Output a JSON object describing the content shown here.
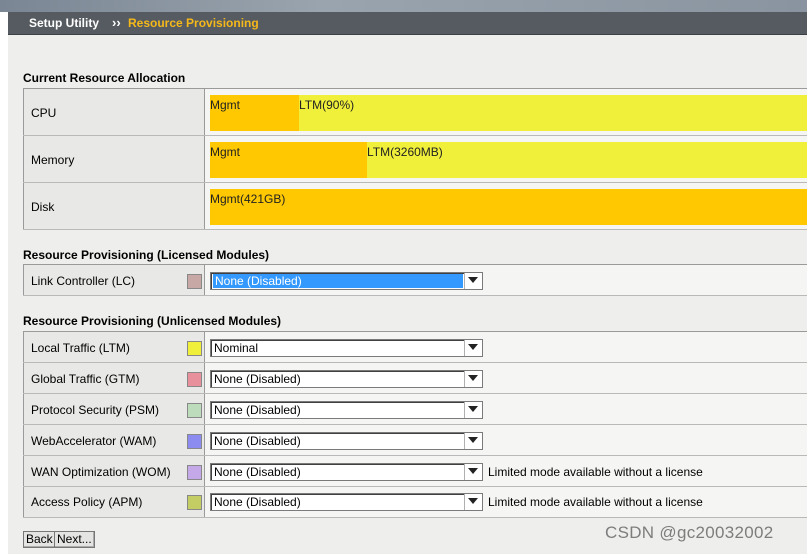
{
  "header": {
    "crumb_root": "Setup Utility",
    "crumb_sep": "››",
    "crumb_current": "Resource Provisioning"
  },
  "allocation": {
    "title": "Current Resource Allocation",
    "rows": [
      {
        "label": "CPU",
        "mgmt_label": "Mgmt",
        "ltm_label": "LTM(90%)",
        "mgmt_fraction": 0.149
      },
      {
        "label": "Memory",
        "mgmt_label": "Mgmt",
        "ltm_label": "LTM(3260MB)",
        "mgmt_fraction": 0.263
      },
      {
        "label": "Disk",
        "mgmt_label": "Mgmt(421GB)",
        "ltm_label": "",
        "mgmt_fraction": 1.0
      }
    ],
    "colors": {
      "mgmt": "#ffc800",
      "ltm": "#f0f03a"
    }
  },
  "licensed": {
    "title": "Resource Provisioning (Licensed Modules)",
    "modules": [
      {
        "label": "Link Controller (LC)",
        "swatch": "#c8a8a4",
        "value": "None (Disabled)",
        "note": ""
      }
    ]
  },
  "unlicensed": {
    "title": "Resource Provisioning (Unlicensed Modules)",
    "modules": [
      {
        "label": "Local Traffic (LTM)",
        "swatch": "#f0f03a",
        "value": "Nominal",
        "note": ""
      },
      {
        "label": "Global Traffic (GTM)",
        "swatch": "#e8909c",
        "value": "None (Disabled)",
        "note": ""
      },
      {
        "label": "Protocol Security (PSM)",
        "swatch": "#bcdcbc",
        "value": "None (Disabled)",
        "note": ""
      },
      {
        "label": "WebAccelerator (WAM)",
        "swatch": "#8c8cf0",
        "value": "None (Disabled)",
        "note": ""
      },
      {
        "label": "WAN Optimization (WOM)",
        "swatch": "#c4a8e8",
        "value": "None (Disabled)",
        "note": "Limited mode available without a license"
      },
      {
        "label": "Access Policy (APM)",
        "swatch": "#c4cc64",
        "value": "None (Disabled)",
        "note": "Limited mode available without a license"
      }
    ]
  },
  "buttons": {
    "back": "Back",
    "next": "Next..."
  },
  "watermark": "CSDN @gc20032002"
}
